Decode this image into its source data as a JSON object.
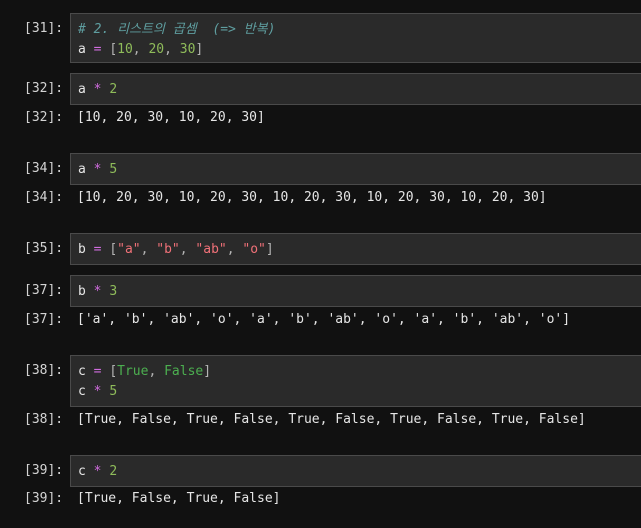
{
  "cells": [
    {
      "input_prompt": "[31]:",
      "lines": [
        [
          {
            "t": "# 2. 리스트의 곱셈  (=> 반복)",
            "c": "comment"
          }
        ],
        [
          {
            "t": "a",
            "c": "name"
          },
          {
            "t": " = ",
            "c": "op"
          },
          {
            "t": "[",
            "c": "punc"
          },
          {
            "t": "10",
            "c": "num"
          },
          {
            "t": ", ",
            "c": "punc"
          },
          {
            "t": "20",
            "c": "num"
          },
          {
            "t": ", ",
            "c": "punc"
          },
          {
            "t": "30",
            "c": "num"
          },
          {
            "t": "]",
            "c": "punc"
          }
        ]
      ],
      "output_prompt": null,
      "output": null
    },
    {
      "input_prompt": "[32]:",
      "lines": [
        [
          {
            "t": "a",
            "c": "name"
          },
          {
            "t": " * ",
            "c": "op"
          },
          {
            "t": "2",
            "c": "num"
          }
        ]
      ],
      "output_prompt": "[32]:",
      "output": "[10, 20, 30, 10, 20, 30]"
    },
    {
      "input_prompt": "[34]:",
      "lines": [
        [
          {
            "t": "a",
            "c": "name"
          },
          {
            "t": " * ",
            "c": "op"
          },
          {
            "t": "5",
            "c": "num"
          }
        ]
      ],
      "output_prompt": "[34]:",
      "output": "[10, 20, 30, 10, 20, 30, 10, 20, 30, 10, 20, 30, 10, 20, 30]"
    },
    {
      "input_prompt": "[35]:",
      "lines": [
        [
          {
            "t": "b",
            "c": "name"
          },
          {
            "t": " = ",
            "c": "op"
          },
          {
            "t": "[",
            "c": "punc"
          },
          {
            "t": "\"a\"",
            "c": "str"
          },
          {
            "t": ", ",
            "c": "punc"
          },
          {
            "t": "\"b\"",
            "c": "str"
          },
          {
            "t": ", ",
            "c": "punc"
          },
          {
            "t": "\"ab\"",
            "c": "str"
          },
          {
            "t": ", ",
            "c": "punc"
          },
          {
            "t": "\"o\"",
            "c": "str"
          },
          {
            "t": "]",
            "c": "punc"
          }
        ]
      ],
      "output_prompt": null,
      "output": null
    },
    {
      "input_prompt": "[37]:",
      "lines": [
        [
          {
            "t": "b",
            "c": "name"
          },
          {
            "t": " * ",
            "c": "op"
          },
          {
            "t": "3",
            "c": "num"
          }
        ]
      ],
      "output_prompt": "[37]:",
      "output": "['a', 'b', 'ab', 'o', 'a', 'b', 'ab', 'o', 'a', 'b', 'ab', 'o']"
    },
    {
      "input_prompt": "[38]:",
      "lines": [
        [
          {
            "t": "c",
            "c": "name"
          },
          {
            "t": " = ",
            "c": "op"
          },
          {
            "t": "[",
            "c": "punc"
          },
          {
            "t": "True",
            "c": "kw"
          },
          {
            "t": ", ",
            "c": "punc"
          },
          {
            "t": "False",
            "c": "kw"
          },
          {
            "t": "]",
            "c": "punc"
          }
        ],
        [
          {
            "t": "c",
            "c": "name"
          },
          {
            "t": " * ",
            "c": "op"
          },
          {
            "t": "5",
            "c": "num"
          }
        ]
      ],
      "output_prompt": "[38]:",
      "output": "[True, False, True, False, True, False, True, False, True, False]"
    },
    {
      "input_prompt": "[39]:",
      "lines": [
        [
          {
            "t": "c",
            "c": "name"
          },
          {
            "t": " * ",
            "c": "op"
          },
          {
            "t": "2",
            "c": "num"
          }
        ]
      ],
      "output_prompt": "[39]:",
      "output": "[True, False, True, False]"
    }
  ]
}
